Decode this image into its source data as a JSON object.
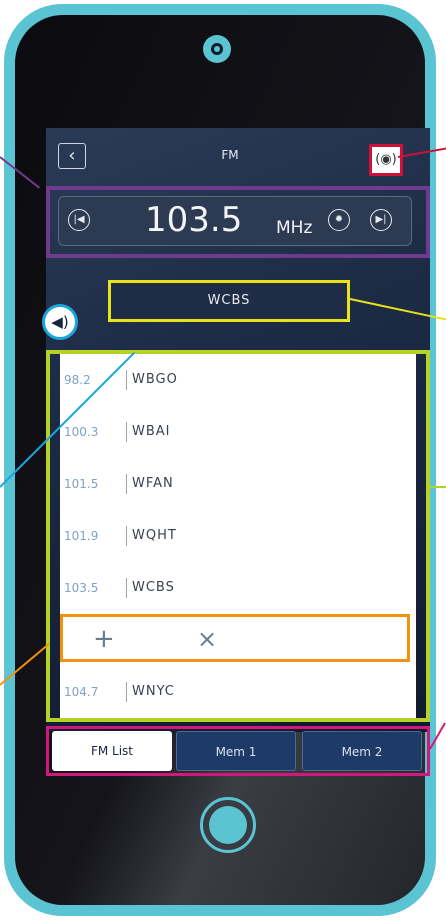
{
  "header": {
    "back_icon": "chevron-left-icon",
    "title": "FM",
    "location_icon": "signal-location-icon"
  },
  "tuner": {
    "prev_icon": "skip-previous-icon",
    "frequency": "103.5",
    "unit": "MHz",
    "settings_icon": "gear-icon",
    "next_icon": "skip-next-icon"
  },
  "volume_icon": "speaker-icon",
  "current_station": "WCBS",
  "stations": [
    {
      "freq": "98.2",
      "name": "WBGO"
    },
    {
      "freq": "100.3",
      "name": "WBAI"
    },
    {
      "freq": "101.5",
      "name": "WFAN"
    },
    {
      "freq": "101.9",
      "name": "WQHT"
    },
    {
      "freq": "103.5",
      "name": "WCBS"
    },
    {
      "freq": "104.7",
      "name": "WNYC"
    }
  ],
  "edit": {
    "add_symbol": "+",
    "remove_symbol": "×"
  },
  "tabs": [
    {
      "label": "FM List",
      "active": true
    },
    {
      "label": "Mem 1",
      "active": false
    },
    {
      "label": "Mem 2",
      "active": false
    }
  ],
  "colors": {
    "phone": "#5bc4d2",
    "frequency_callout": "#6e3b8e",
    "location_callout": "#d0103a",
    "station_callout": "#e8e21a",
    "list_callout": "#b5d22a",
    "edit_callout": "#f0920e",
    "tabs_callout": "#d4177a",
    "volume_callout": "#1aa5dc"
  }
}
